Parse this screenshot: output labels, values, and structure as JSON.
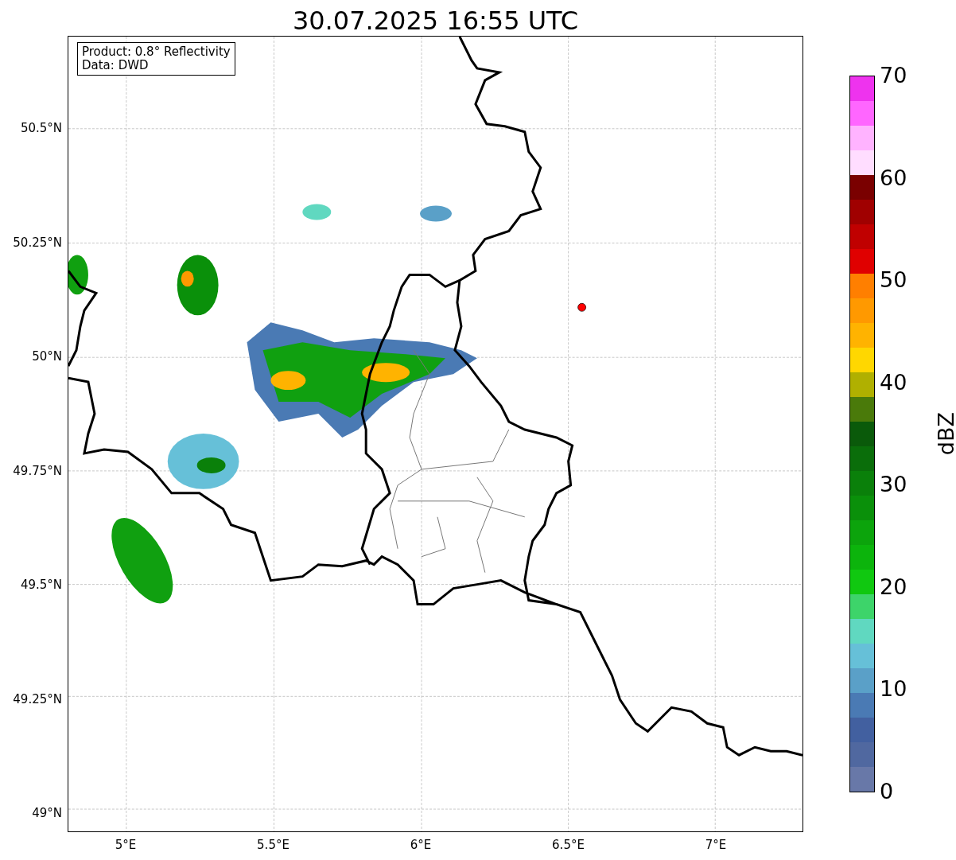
{
  "title": "30.07.2025 16:55 UTC",
  "info_box": [
    "Product: 0.8° Reflectivity",
    "Data: DWD"
  ],
  "map": {
    "x_ticks": [
      "5°E",
      "5.5°E",
      "6°E",
      "6.5°E",
      "7°E"
    ],
    "y_ticks": [
      "50.5°N",
      "50.25°N",
      "50°N",
      "49.75°N",
      "49.5°N",
      "49.25°N",
      "49°N"
    ]
  },
  "colorbar": {
    "label": "dBZ",
    "ticks": [
      "70",
      "60",
      "50",
      "40",
      "30",
      "20",
      "10",
      "0"
    ],
    "segments": [
      {
        "color": "#6878a8"
      },
      {
        "color": "#5068a0"
      },
      {
        "color": "#4260a0"
      },
      {
        "color": "#4a7ab4"
      },
      {
        "color": "#5aa0c8"
      },
      {
        "color": "#66c0d8"
      },
      {
        "color": "#60d8c0"
      },
      {
        "color": "#3dd46a"
      },
      {
        "color": "#10c810"
      },
      {
        "color": "#0cb40c"
      },
      {
        "color": "#0ca40c"
      },
      {
        "color": "#0a900a"
      },
      {
        "color": "#0a800a"
      },
      {
        "color": "#0a6e0a"
      },
      {
        "color": "#0a5a0a"
      },
      {
        "color": "#4a7a0a"
      },
      {
        "color": "#b0b000"
      },
      {
        "color": "#ffd700"
      },
      {
        "color": "#ffb300"
      },
      {
        "color": "#ff9900"
      },
      {
        "color": "#ff7f00"
      },
      {
        "color": "#e00000"
      },
      {
        "color": "#c00000"
      },
      {
        "color": "#a00000"
      },
      {
        "color": "#7a0000"
      },
      {
        "color": "#ffddff"
      },
      {
        "color": "#ffb3ff"
      },
      {
        "color": "#ff66ff"
      },
      {
        "color": "#ee33ee"
      }
    ]
  }
}
